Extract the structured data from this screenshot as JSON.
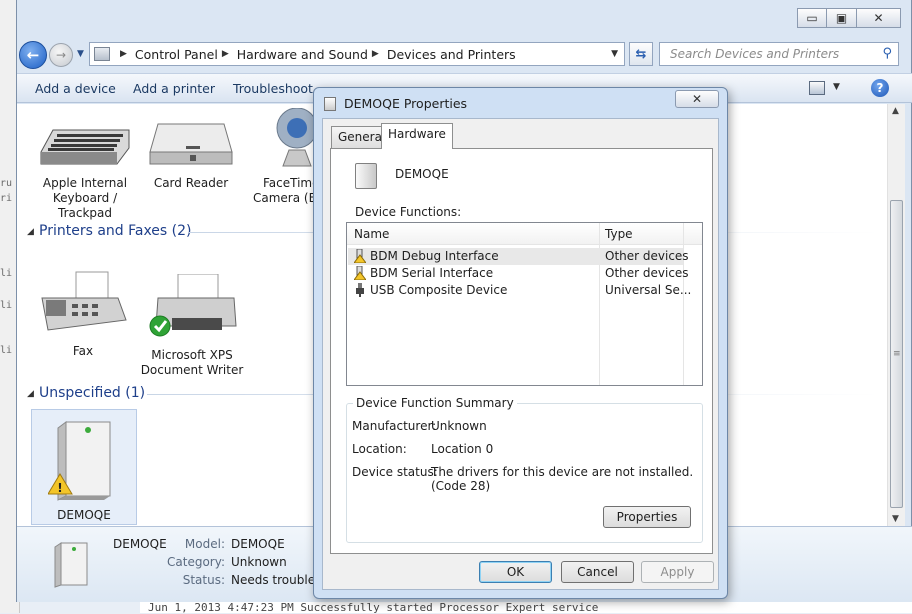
{
  "background": {
    "code_lines": [
      "ru",
      "ri",
      "li",
      "li",
      "li"
    ],
    "bottom_log": "Jun 1, 2013 4:47:23 PM Successfully started Processor Expert service"
  },
  "explorer": {
    "window_buttons": {
      "minimize": "▭",
      "maximize": "▣",
      "close": "✕"
    },
    "breadcrumb": [
      "Control Panel",
      "Hardware and Sound",
      "Devices and Printers"
    ],
    "search_placeholder": "Search Devices and Printers",
    "commands": [
      "Add a device",
      "Add a printer",
      "Troubleshoot"
    ],
    "devices": [
      {
        "label_lines": [
          "Apple Internal",
          "Keyboard /",
          "Trackpad"
        ]
      },
      {
        "label_lines": [
          "Card Reader"
        ]
      },
      {
        "label_lines": [
          "FaceTime",
          "Camera (Bui"
        ]
      }
    ],
    "groups": {
      "printers": {
        "title": "Printers and Faxes (2)",
        "items": [
          {
            "label_lines": [
              "Fax"
            ]
          },
          {
            "label_lines": [
              "Microsoft XPS",
              "Document Writer"
            ]
          }
        ]
      },
      "unspecified": {
        "title": "Unspecified (1)",
        "items": [
          {
            "label_lines": [
              "DEMOQE"
            ]
          }
        ]
      }
    },
    "details": {
      "name": "DEMOQE",
      "model_label": "Model:",
      "model": "DEMOQE",
      "category_label": "Category:",
      "category": "Unknown",
      "status_label": "Status:",
      "status": "Needs troublesh"
    }
  },
  "dialog": {
    "title": "DEMOQE Properties",
    "close": "✕",
    "tabs": [
      "General",
      "Hardware"
    ],
    "active_tab": "Hardware",
    "device_name": "DEMOQE",
    "functions_label": "Device Functions:",
    "columns": [
      "Name",
      "Type"
    ],
    "rows": [
      {
        "name": "BDM Debug Interface",
        "type": "Other devices",
        "icon": "warning-device-icon"
      },
      {
        "name": "BDM Serial Interface",
        "type": "Other devices",
        "icon": "warning-device-icon"
      },
      {
        "name": "USB Composite Device",
        "type": "Universal Se...",
        "icon": "usb-icon"
      }
    ],
    "summary": {
      "legend": "Device Function Summary",
      "manufacturer_label": "Manufacturer:",
      "manufacturer": "Unknown",
      "location_label": "Location:",
      "location": "Location 0",
      "status_label": "Device status:",
      "status": "The drivers for this device are not installed. (Code 28)",
      "properties_button": "Properties"
    },
    "buttons": {
      "ok": "OK",
      "cancel": "Cancel",
      "apply": "Apply"
    }
  }
}
